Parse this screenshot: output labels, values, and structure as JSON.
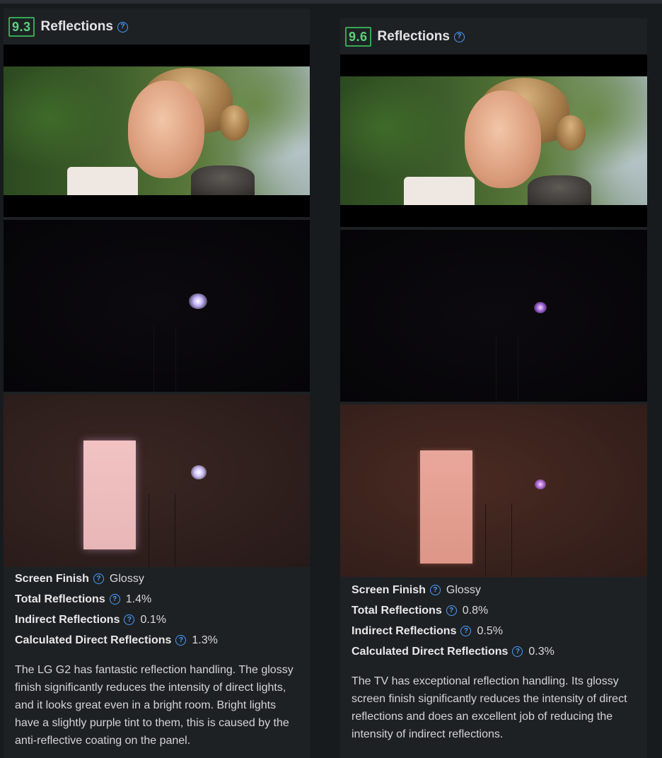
{
  "colors": {
    "score_green": "#34a853",
    "help_blue": "#4a9eff",
    "panel_bg": "#1e2124"
  },
  "panels": [
    {
      "score": "9.3",
      "title": "Reflections",
      "help_icon": "question-circle-icon",
      "stats": [
        {
          "label": "Screen Finish",
          "value": "Glossy"
        },
        {
          "label": "Total Reflections",
          "value": "1.4%"
        },
        {
          "label": "Indirect Reflections",
          "value": "0.1%"
        },
        {
          "label": "Calculated Direct Reflections",
          "value": "1.3%"
        }
      ],
      "description": "The LG G2 has fantastic reflection handling. The glossy finish significantly reduces the intensity of direct lights, and it looks great even in a bright room. Bright lights have a slightly purple tint to them, this is caused by the anti-reflective coating on the panel."
    },
    {
      "score": "9.6",
      "title": "Reflections",
      "help_icon": "question-circle-icon",
      "stats": [
        {
          "label": "Screen Finish",
          "value": "Glossy"
        },
        {
          "label": "Total Reflections",
          "value": "0.8%"
        },
        {
          "label": "Indirect Reflections",
          "value": "0.5%"
        },
        {
          "label": "Calculated Direct Reflections",
          "value": "0.3%"
        }
      ],
      "description": "The TV has exceptional reflection handling. Its glossy screen finish significantly reduces the intensity of direct reflections and does an excellent job of reducing the intensity of indirect reflections."
    }
  ]
}
